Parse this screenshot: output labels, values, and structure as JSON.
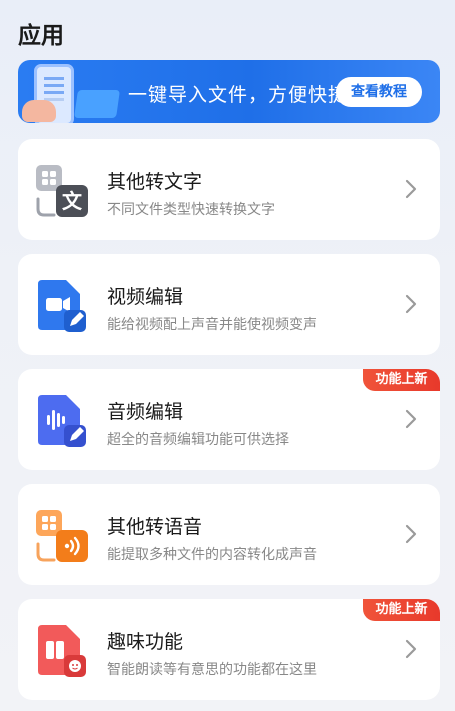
{
  "page": {
    "title": "应用"
  },
  "banner": {
    "text": "一键导入文件，方便快捷",
    "button_label": "查看教程"
  },
  "items": [
    {
      "title": "其他转文字",
      "desc": "不同文件类型快速转换文字",
      "icon": "doc-to-text-icon",
      "badge": ""
    },
    {
      "title": "视频编辑",
      "desc": "能给视频配上声音并能使视频变声",
      "icon": "video-edit-icon",
      "badge": ""
    },
    {
      "title": "音频编辑",
      "desc": "超全的音频编辑功能可供选择",
      "icon": "audio-edit-icon",
      "badge": "功能上新"
    },
    {
      "title": "其他转语音",
      "desc": "能提取多种文件的内容转化成声音",
      "icon": "doc-to-speech-icon",
      "badge": ""
    },
    {
      "title": "趣味功能",
      "desc": "智能朗读等有意思的功能都在这里",
      "icon": "fun-feature-icon",
      "badge": "功能上新"
    }
  ],
  "colors": {
    "accent": "#1f6fe8",
    "badge": "#e8392b"
  }
}
